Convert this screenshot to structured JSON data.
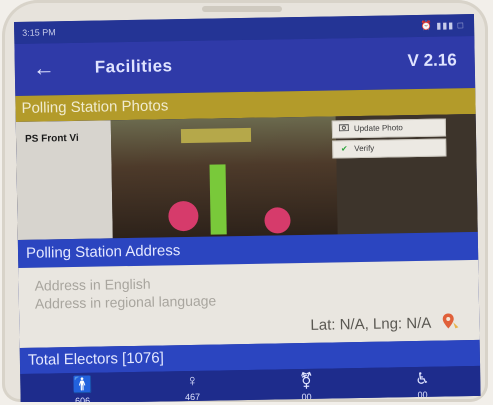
{
  "status_bar": {
    "time": "3:15 PM",
    "indicators": "⏰ ▮▮▮ □"
  },
  "app_bar": {
    "back_icon": "←",
    "title": "Facilities",
    "version": "V 2.16"
  },
  "photos_section": {
    "header": "Polling Station Photos",
    "photo_label": "PS Front Vi",
    "upload_button": "Update Photo",
    "verify_button": "Verify"
  },
  "address_section": {
    "header": "Polling Station Address",
    "english_placeholder": "Address in English",
    "regional_placeholder": "Address in regional language",
    "lat_lng": "Lat: N/A, Lng: N/A"
  },
  "electors_section": {
    "header": "Total Electors [1076]",
    "stats": [
      {
        "icon": "male-icon",
        "glyph": "🚹",
        "value": "606"
      },
      {
        "icon": "female-icon",
        "glyph": "♀",
        "value": "467"
      },
      {
        "icon": "transgender-icon",
        "glyph": "⚧",
        "value": "00"
      },
      {
        "icon": "wheelchair-icon",
        "glyph": "♿",
        "value": "00"
      }
    ]
  },
  "colors": {
    "app_bar": "#2f3aa8",
    "photos_header": "#b39b2a",
    "section_header": "#2b45c0",
    "verify_check": "#2aa33a",
    "pin": "#e0603a"
  }
}
